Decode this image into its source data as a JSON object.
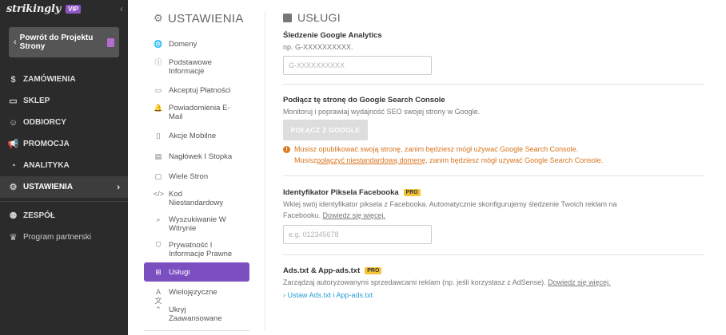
{
  "brand": {
    "logo": "strikingly",
    "badge": "VIP",
    "collapse": "‹"
  },
  "back": {
    "label": "Powrót do Projektu Strony"
  },
  "nav": [
    {
      "name": "nav-item-orders",
      "label": "ZAMÓWIENIA",
      "icon": "$"
    },
    {
      "name": "nav-item-store",
      "label": "SKLEP",
      "icon": "▭"
    },
    {
      "name": "nav-item-audience",
      "label": "ODBIORCY",
      "icon": "☺"
    },
    {
      "name": "nav-item-promotion",
      "label": "PROMOCJA",
      "icon": "📢"
    },
    {
      "name": "nav-item-analytics",
      "label": "ANALITYKA",
      "icon": "◔"
    },
    {
      "name": "nav-item-settings",
      "label": "USTAWIENIA",
      "icon": "⚙"
    }
  ],
  "nav_team": {
    "label": "ZESPÓŁ",
    "icon": "⚉"
  },
  "nav_partner": {
    "label": "Program partnerski",
    "icon": "♛"
  },
  "settings": {
    "title": "USTAWIENIA",
    "items": [
      {
        "label": "Domeny",
        "icon": "🌐"
      },
      {
        "label": "Podstawowe Informacje",
        "icon": "ⓘ"
      },
      {
        "label": "Akceptuj Płatności",
        "icon": "▭"
      },
      {
        "label": "Powiadomienia E-Mail",
        "icon": "🔔"
      },
      {
        "label": "Akcje Mobilne",
        "icon": "▯"
      },
      {
        "label": "Nagłówek I Stopka",
        "icon": "▤"
      },
      {
        "label": "Wiele Stron",
        "icon": "▢"
      },
      {
        "label": "Kod Niestandardowy",
        "icon": "</>"
      },
      {
        "label": "Wyszukiwanie W Witrynie",
        "icon": "⌕"
      },
      {
        "label": "Prywatność I Informacje Prawne",
        "icon": "⛉"
      },
      {
        "label": "Usługi",
        "icon": "⊞"
      },
      {
        "label": "Wielojęzyczne",
        "icon": "A文"
      },
      {
        "label": "Ukryj Zaawansowane",
        "icon": "⌃"
      }
    ]
  },
  "main": {
    "title": "USŁUGI",
    "ga": {
      "title": "Śledzenie Google Analytics",
      "hint": "np. G-XXXXXXXXXX.",
      "placeholder": "G-XXXXXXXXXX"
    },
    "gsc": {
      "title": "Podłącz tę stronę do Google Search Console",
      "desc": "Monitoruj i poprawiaj wydajność SEO swojej strony w Google.",
      "button": "POŁĄCZ Z GOOGLE",
      "warn1": "Musisz opublikować swoją stronę, zanim będziesz mógł używać Google Search Console.",
      "warn2_pre": "Musisz ",
      "warn2_link": "połączyć niestandardową domenę",
      "warn2_post": ", zanim będziesz mógł używać Google Search Console."
    },
    "fb": {
      "title": "Identyfikator Piksela Facebooka",
      "badge": "PRO",
      "desc": "Wklej swój identyfikator piksela z Facebooka. Automatycznie skonfigurujemy śledzenie Twoich reklam na Facebooku. ",
      "more": "Dowiedz się więcej.",
      "placeholder": "e.g. 012345678"
    },
    "ads": {
      "title": "Ads.txt & App-ads.txt",
      "badge": "PRO",
      "desc": "Zarządzaj autoryzowanymi sprzedawcami reklam (np. jeśli korzystasz z AdSense). ",
      "more": "Dowiedz się więcej.",
      "link": "› Ustaw Ads.txt i App-ads.txt"
    }
  }
}
